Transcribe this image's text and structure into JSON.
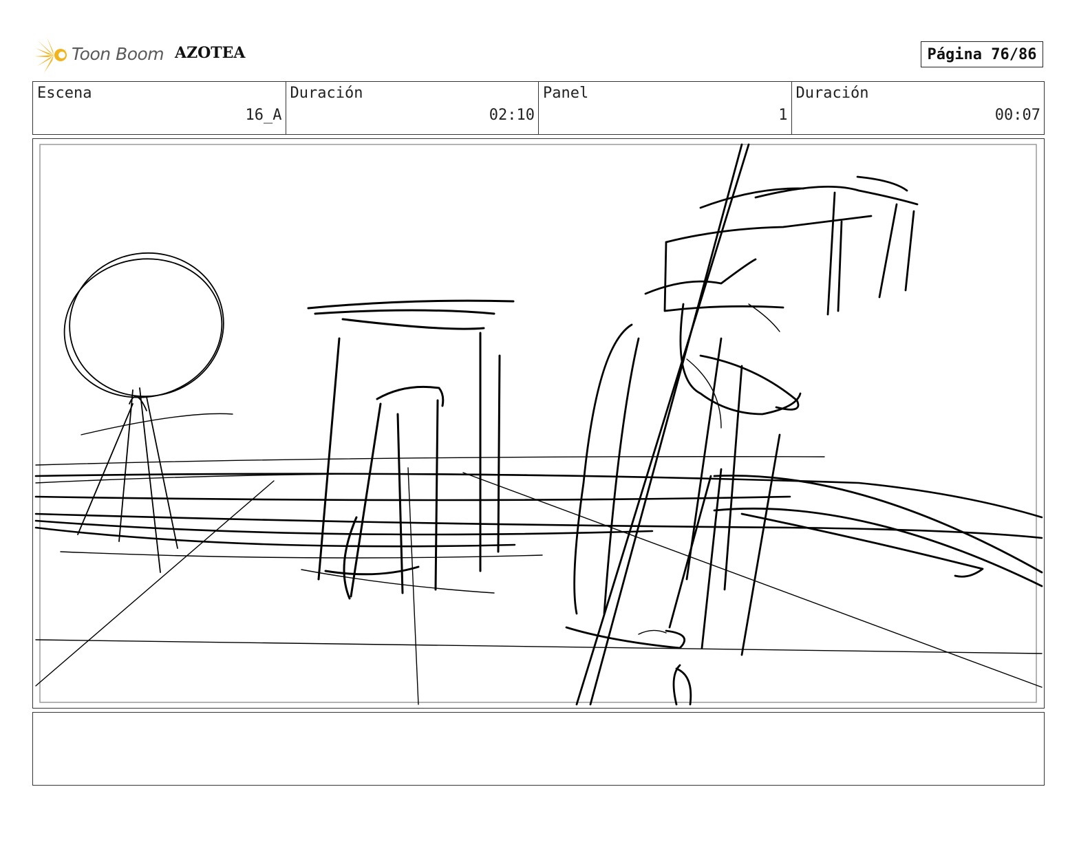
{
  "header": {
    "brand": "Toon Boom",
    "project_title": "AZOTEA",
    "page_label": "Página 76/86"
  },
  "info": [
    {
      "label": "Escena",
      "value": "16_A"
    },
    {
      "label": "Duración",
      "value": "02:10"
    },
    {
      "label": "Panel",
      "value": "1"
    },
    {
      "label": "Duración",
      "value": "00:07"
    }
  ],
  "colors": {
    "logo_star": "#f2b31b",
    "logo_text": "#5a5a5a",
    "border": "#333333",
    "sketch_line": "#000000"
  },
  "panel": {
    "content": "rough pencil storyboard sketch"
  },
  "notes": {
    "text": ""
  }
}
